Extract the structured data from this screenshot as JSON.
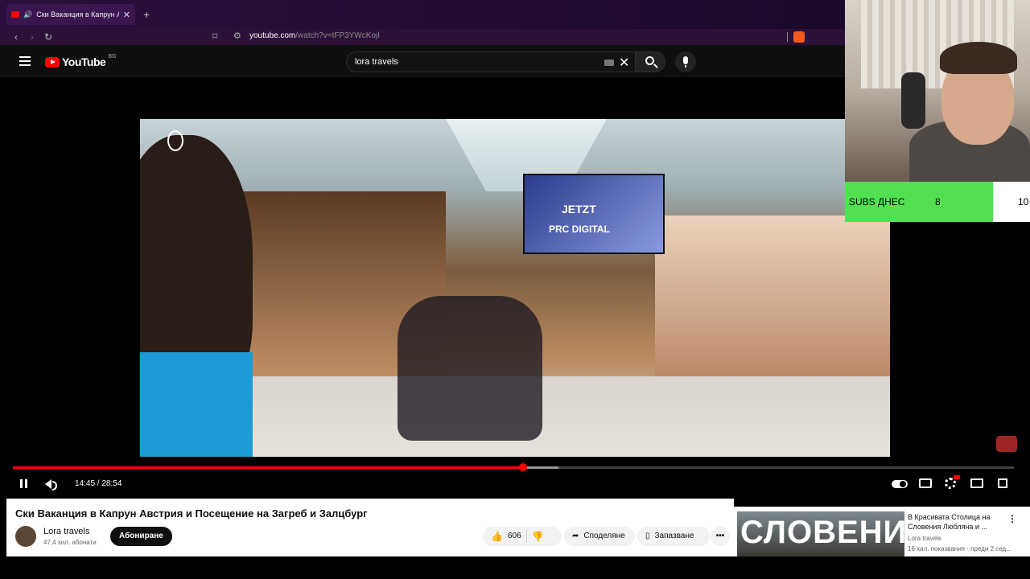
{
  "browser": {
    "tab_title": "Ски Ваканция в Капрун Австр",
    "url_host": "youtube.com",
    "url_rest": "/watch?v=tFP3YWcKojI"
  },
  "youtube": {
    "logo_text": "YouTube",
    "country_code": "BG",
    "search_query": "lora travels"
  },
  "video_overlay": {
    "screen_line1": "JETZT",
    "screen_line2": "PRC DIGITAL"
  },
  "player": {
    "current_time": "14:45",
    "duration": "28:54",
    "time_display": "14:45 / 28:54",
    "played_fraction": 0.51,
    "buffered_fraction": 0.545
  },
  "video": {
    "title": "Ски Ваканция в Капрун Австрия и Посещение на Загреб и Залцбург",
    "channel_name": "Lora travels",
    "subscribers": "47,4 хил. абонати",
    "subscribe_label": "Абониране",
    "like_count": "606",
    "share_label": "Споделяне",
    "save_label": "Запазване",
    "more_label": "•••"
  },
  "recommendation": {
    "thumb_text": "СЛОВЕНИЯ",
    "title": "В Красивата Столица на Словения Любляна и ...",
    "channel": "Lora travels",
    "meta": "16 хил. показвания · преди 2 сед..."
  },
  "webcam_widget": {
    "label": "SUBS ДНЕС",
    "current": "8",
    "goal": "10",
    "progress_fraction": 0.8
  },
  "colors": {
    "accent": "#ff0000",
    "subs_bar": "#52e052",
    "browser_bg": "#2a0f3a"
  }
}
